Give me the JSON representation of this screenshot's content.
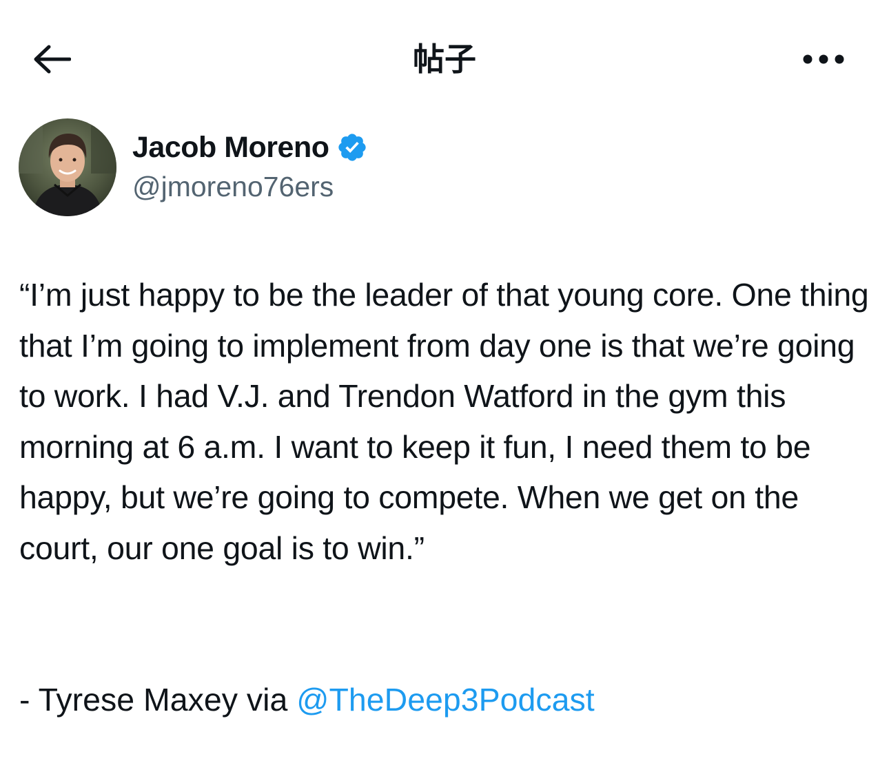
{
  "header": {
    "title": "帖子",
    "back_icon": "arrow-left-icon",
    "more_icon": "more-horizontal-icon"
  },
  "author": {
    "name": "Jacob Moreno",
    "handle": "@jmoreno76ers",
    "verified": true,
    "verified_color": "#1d9bf0"
  },
  "post": {
    "text": "“I’m just happy to be the leader of that young core. One thing that I’m going to implement from day one is that we’re going to work. I had V.J. and Trendon Watford in the gym this morning at 6 a.m. I want to keep it fun, I need them to be happy, but we’re going to compete. When we get on the court, our one goal is to win.”",
    "attribution_prefix": "- Tyrese Maxey via ",
    "mention": "@TheDeep3Podcast"
  },
  "colors": {
    "text": "#0f1419",
    "secondary": "#536471",
    "link": "#1d9bf0"
  }
}
